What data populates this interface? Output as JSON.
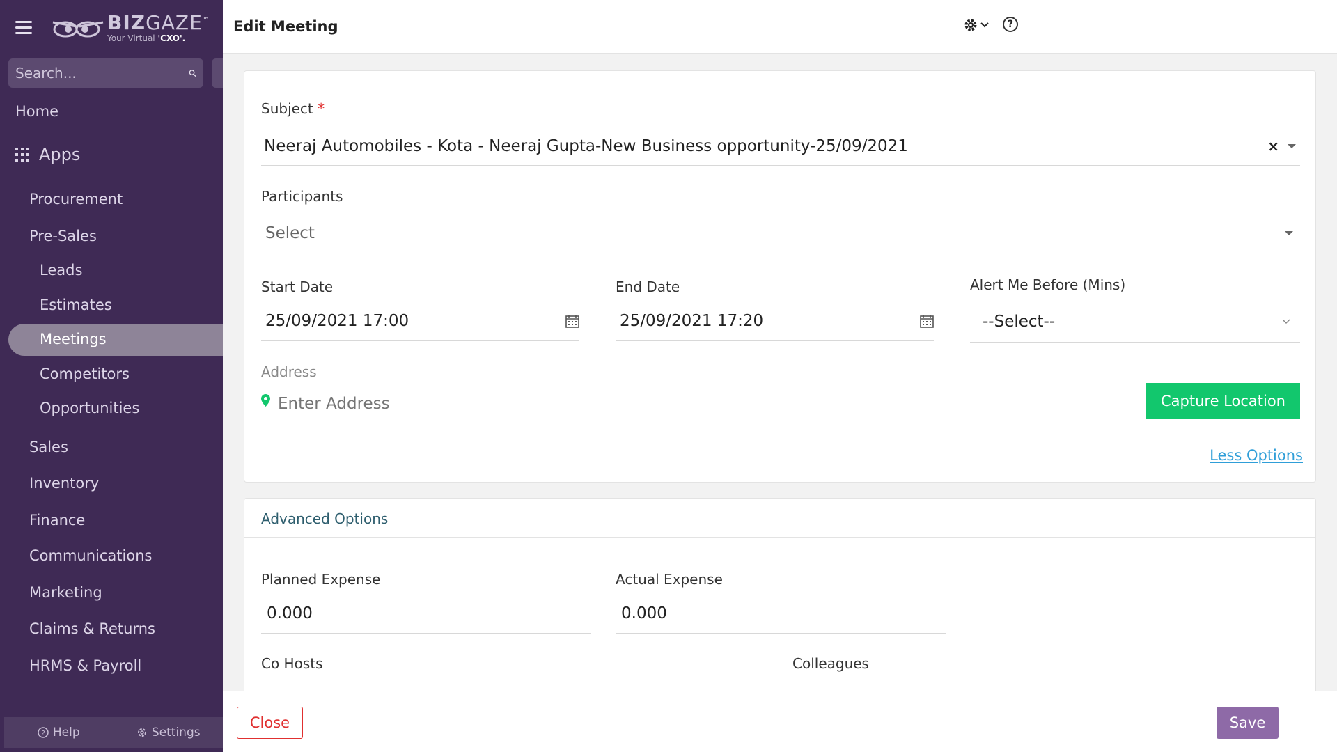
{
  "sidebar": {
    "logo_main_bold": "BIZ",
    "logo_main_thin": "GAZE",
    "logo_tm": "™",
    "logo_sub_prefix": "Your Virtual ",
    "logo_sub_bold": "'CXO'.",
    "search_placeholder": "Search...",
    "home": "Home",
    "apps": "Apps",
    "items": [
      {
        "label": "Procurement",
        "level": 1
      },
      {
        "label": "Pre-Sales",
        "level": 1
      },
      {
        "label": "Leads",
        "level": 2
      },
      {
        "label": "Estimates",
        "level": 2
      },
      {
        "label": "Meetings",
        "level": 2,
        "active": true
      },
      {
        "label": "Competitors",
        "level": 2
      },
      {
        "label": "Opportunities",
        "level": 2
      },
      {
        "label": "Sales",
        "level": 1
      },
      {
        "label": "Inventory",
        "level": 1
      },
      {
        "label": "Finance",
        "level": 1
      },
      {
        "label": "Communications",
        "level": 1
      },
      {
        "label": "Marketing",
        "level": 1
      },
      {
        "label": "Claims & Returns",
        "level": 1
      },
      {
        "label": "HRMS & Payroll",
        "level": 1
      }
    ],
    "footer_help": "Help",
    "footer_settings": "Settings"
  },
  "header": {
    "title": "Edit Meeting"
  },
  "form": {
    "subject_label": "Subject",
    "subject_required": "*",
    "subject_value": "Neeraj Automobiles - Kota - Neeraj Gupta-New Business opportunity-25/09/2021",
    "participants_label": "Participants",
    "participants_value": "Select",
    "start_label": "Start Date",
    "start_value": "25/09/2021 17:00",
    "end_label": "End Date",
    "end_value": "25/09/2021 17:20",
    "alert_label": "Alert Me Before (Mins)",
    "alert_value": "--Select--",
    "address_label": "Address",
    "address_placeholder": "Enter Address",
    "capture_label": "Capture Location",
    "less_options": "Less Options"
  },
  "advanced": {
    "title": "Advanced Options",
    "planned_label": "Planned Expense",
    "planned_value": "0.000",
    "actual_label": "Actual Expense",
    "actual_value": "0.000",
    "cohosts_label": "Co Hosts",
    "colleagues_label": "Colleagues"
  },
  "footer": {
    "close_label": "Close",
    "save_label": "Save"
  },
  "colors": {
    "sidebar_bg": "#3f2a55",
    "accent_green": "#12c76d",
    "save_purple": "#8e6aa7",
    "close_red": "#e03030",
    "link_blue": "#2f9ed8"
  }
}
